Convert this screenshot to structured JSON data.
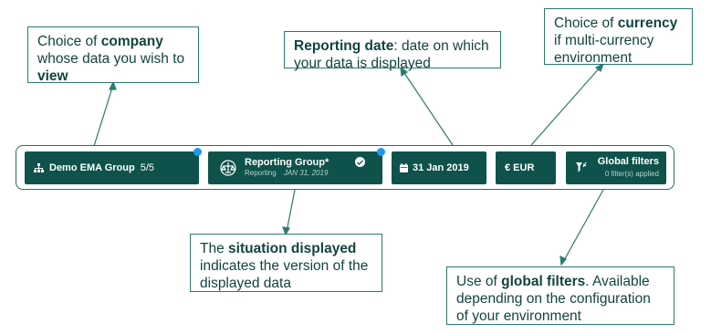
{
  "callouts": {
    "company": {
      "pre": "Choice of ",
      "bold": "company",
      "mid": " whose data you wish to ",
      "bold2": "view"
    },
    "reporting": {
      "bold": "Reporting date",
      "rest": ": date on which your data is displayed"
    },
    "currency": {
      "pre": "Choice of ",
      "bold": "currency",
      "rest": " if multi-currency environment"
    },
    "situation": {
      "pre": "The ",
      "bold": "situation displayed",
      "rest": " indicates the version of the displayed data"
    },
    "filters": {
      "pre": "Use of ",
      "bold": "global filters",
      "rest": ". Available depending on the configuration of your environment"
    }
  },
  "toolbar": {
    "company": {
      "label": "Demo EMA Group",
      "count": "5/5",
      "icon": "org-chart-icon"
    },
    "situation": {
      "title": "Reporting Group*",
      "sub_label": "Reporting",
      "sub_date": "JAN 31, 2019",
      "icon": "balance-scale-icon",
      "status_icon": "check-circle-icon"
    },
    "date": {
      "label": "31 Jan 2019",
      "icon": "calendar-icon"
    },
    "currency": {
      "label": "€ EUR"
    },
    "filters": {
      "title": "Global filters",
      "sub": "0 filter(s) applied",
      "icon": "filter-icon"
    }
  },
  "colors": {
    "button_bg": "#0e524b",
    "accent_dot": "#2196f3",
    "callout_border": "#2a7a72"
  }
}
